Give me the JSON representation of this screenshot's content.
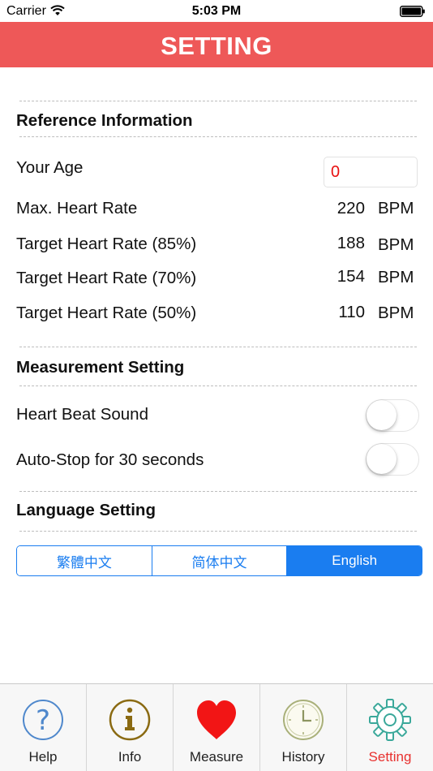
{
  "status_bar": {
    "carrier": "Carrier",
    "time": "5:03 PM"
  },
  "header": {
    "title": "SETTING"
  },
  "reference": {
    "title": "Reference Information",
    "age_label": "Your Age",
    "age_value": "0",
    "unit": "BPM",
    "rows": [
      {
        "label": "Max. Heart Rate",
        "value": "220"
      },
      {
        "label": "Target Heart Rate (85%)",
        "value": "188"
      },
      {
        "label": "Target Heart Rate (70%)",
        "value": "154"
      },
      {
        "label": "Target Heart Rate (50%)",
        "value": "110"
      }
    ]
  },
  "measurement": {
    "title": "Measurement Setting",
    "heart_beat_sound_label": "Heart Beat Sound",
    "heart_beat_sound_on": false,
    "auto_stop_label": "Auto-Stop for 30 seconds",
    "auto_stop_on": false
  },
  "language": {
    "title": "Language Setting",
    "options": [
      "繁體中文",
      "简体中文",
      "English"
    ],
    "selected": "English"
  },
  "tabs": [
    {
      "label": "Help",
      "icon": "help-icon"
    },
    {
      "label": "Info",
      "icon": "info-icon"
    },
    {
      "label": "Measure",
      "icon": "heart-icon"
    },
    {
      "label": "History",
      "icon": "clock-icon"
    },
    {
      "label": "Setting",
      "icon": "gear-icon",
      "active": true
    }
  ],
  "colors": {
    "header": "#ee5858",
    "accent": "#1a7df0",
    "active_tab": "#e8312f",
    "age_value": "#e81010"
  }
}
